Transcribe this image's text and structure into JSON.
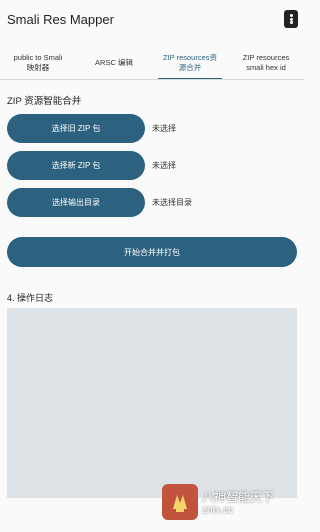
{
  "app": {
    "title": "Smali Res Mapper"
  },
  "tabs": [
    {
      "line1": "public to Smali",
      "line2": "映射器"
    },
    {
      "line1": "ARSC 编辑",
      "line2": ""
    },
    {
      "line1": "ZIP resources资",
      "line2": "源合并"
    },
    {
      "line1": "ZIP resources",
      "line2": "smali hex id"
    }
  ],
  "main": {
    "section_title": "ZIP 资源智能合并",
    "rows": [
      {
        "button": "选择旧 ZIP 包",
        "status": "未选择"
      },
      {
        "button": "选择新 ZIP 包",
        "status": "未选择"
      },
      {
        "button": "选择输出目录",
        "status": "未选择目录"
      }
    ],
    "merge_button": "开始合并并打包",
    "log_title": "4. 操作日志",
    "log_content": ""
  },
  "watermark": {
    "line1": "八神智能天下",
    "line2": "zntx.cc"
  },
  "colors": {
    "primary": "#2c617f",
    "log_bg": "#dde2e6",
    "page_bg": "#fafafa"
  }
}
